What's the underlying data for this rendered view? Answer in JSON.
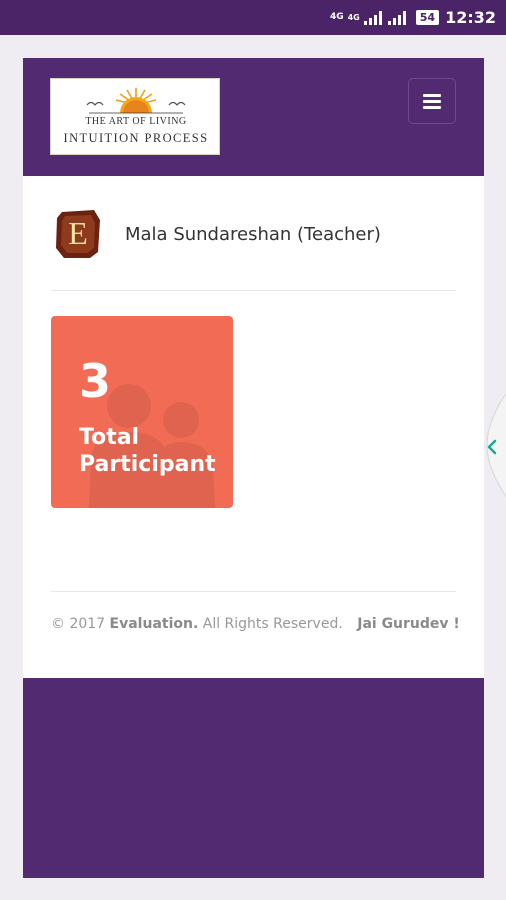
{
  "status_bar": {
    "network_label_top": "4G",
    "network_label_mid": "4G",
    "battery": "54",
    "time": "12:32"
  },
  "header": {
    "logo_line1": "THE ART OF LIVING",
    "logo_line2": "INTUITION PROCESS",
    "menu_icon": "hamburger-menu-icon"
  },
  "teacher": {
    "avatar_letter": "E",
    "name": "Mala Sundareshan (Teacher)"
  },
  "stats": {
    "count": "3",
    "label": "Total Participant",
    "color": "#f26c55"
  },
  "footer": {
    "copyright": "© 2017",
    "brand": "Evaluation.",
    "rights": "All Rights Reserved.",
    "greeting": "Jai Gurudev !"
  },
  "colors": {
    "primary": "#522a72",
    "status_bar": "#4a2466",
    "handle_chevron": "#1aa89a"
  }
}
